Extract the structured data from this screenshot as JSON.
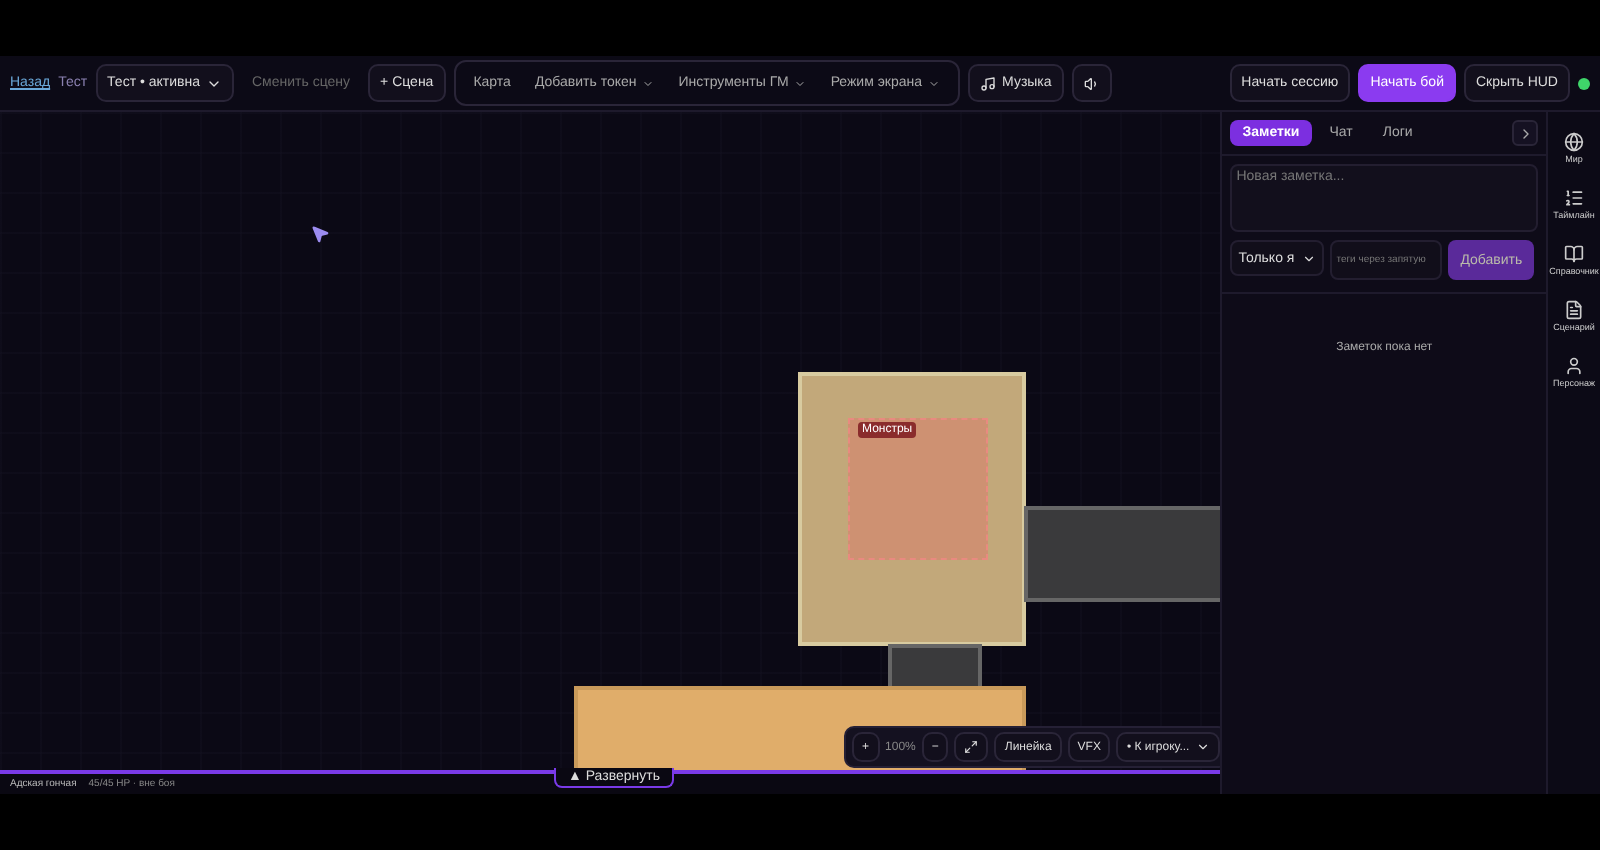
{
  "toolbar": {
    "back_link": "Назад",
    "campaign": "Тест",
    "scene_select": "Тест • активна",
    "change_scene": "Сменить сцену",
    "add_scene": "+ Сцена",
    "tools": [
      {
        "label": "Карта",
        "dropdown": false
      },
      {
        "label": "Добавить токен",
        "dropdown": true
      },
      {
        "label": "Инструменты ГМ",
        "dropdown": true
      },
      {
        "label": "Режим экрана",
        "dropdown": true
      }
    ],
    "music": "Музыка",
    "start_session": "Начать сессию",
    "start_battle": "Начать бой",
    "hide_hud": "Скрыть HUD",
    "online": true
  },
  "map": {
    "zone_label": "Монстры"
  },
  "zoom_bar": {
    "plus": "+",
    "zoom": "100%",
    "minus": "−",
    "ruler": "Линейка",
    "vfx": "VFX",
    "to_player": "• К игроку..."
  },
  "status_bar": {
    "name": "Адская гончая",
    "info": "45/45 HP · вне боя",
    "expand": "▲ Развернуть"
  },
  "panel": {
    "tabs": [
      {
        "label": "Заметки",
        "selected": true
      },
      {
        "label": "Чат",
        "selected": false
      },
      {
        "label": "Логи",
        "selected": false
      }
    ],
    "note_placeholder": "Новая заметка...",
    "visibility": "Только я",
    "tags_placeholder": "теги через запятую",
    "add": "Добавить",
    "empty": "Заметок пока нет"
  },
  "rail": [
    {
      "kind": "globe",
      "label": "Мир"
    },
    {
      "kind": "list",
      "label": "Таймлайн"
    },
    {
      "kind": "book",
      "label": "Справочник"
    },
    {
      "kind": "file",
      "label": "Сценарий"
    },
    {
      "kind": "user",
      "label": "Персонаж"
    }
  ]
}
